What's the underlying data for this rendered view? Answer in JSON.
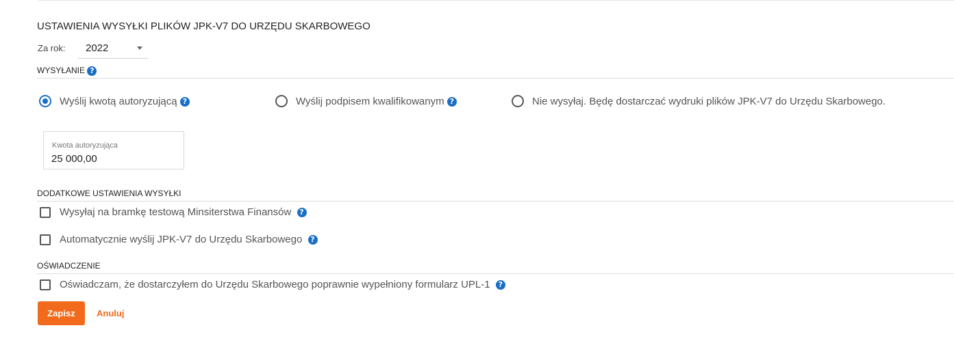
{
  "title": "USTAWIENIA WYSYŁKI PLIKÓW JPK-V7 DO URZĘDU SKARBOWEGO",
  "year": {
    "label": "Za rok:",
    "value": "2022"
  },
  "sending": {
    "heading": "WYSYŁANIE",
    "options": [
      {
        "label": "Wyślij kwotą autoryzującą",
        "selected": true,
        "help": true
      },
      {
        "label": "Wyślij podpisem kwalifikowanym",
        "selected": false,
        "help": true
      },
      {
        "label": "Nie wysyłaj. Będę dostarczać wydruki plików JPK-V7 do Urzędu Skarbowego.",
        "selected": false,
        "help": false
      }
    ],
    "amount": {
      "label": "Kwota autoryzująca",
      "value": "25 000,00"
    }
  },
  "additional": {
    "heading": "DODATKOWE USTAWIENIA WYSYŁKI",
    "options": [
      {
        "label": "Wysyłaj na bramkę testową Minsiterstwa Finansów",
        "checked": false
      },
      {
        "label": "Automatycznie wyślij JPK-V7 do Urzędu Skarbowego",
        "checked": false
      }
    ]
  },
  "declaration": {
    "heading": "OŚWIADCZENIE",
    "label": "Oświadczam, że dostarczyłem do Urzędu Skarbowego poprawnie wypełniony formularz UPL-1",
    "checked": false
  },
  "help_glyph": "?",
  "buttons": {
    "save": "Zapisz",
    "cancel": "Anuluj"
  },
  "colors": {
    "accent": "#f26a1b",
    "help_icon": "#1a6fc4",
    "radio_selected": "#1a6fc4"
  }
}
